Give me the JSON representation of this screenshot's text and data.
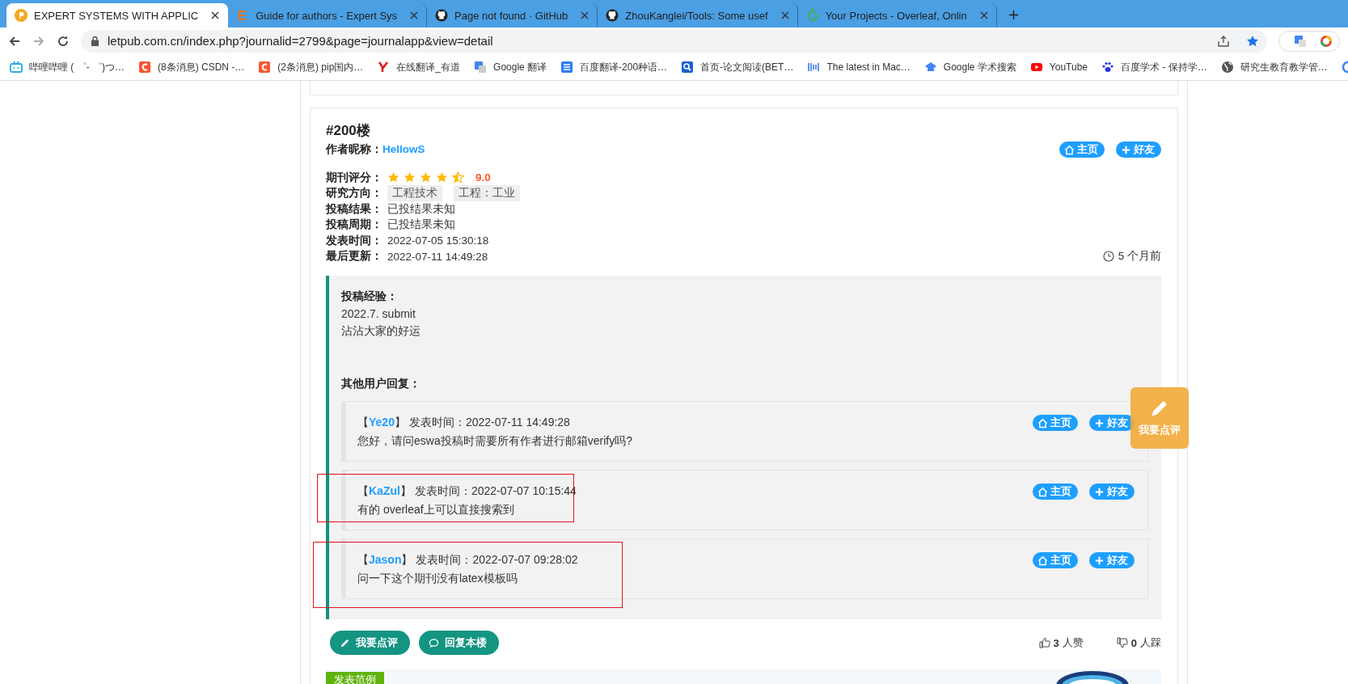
{
  "browser": {
    "tabs": [
      {
        "kind": "letpub",
        "title": "EXPERT SYSTEMS WITH APPLIC",
        "selected": true
      },
      {
        "kind": "elsevier",
        "title": "Guide for authors - Expert Sys",
        "selected": false
      },
      {
        "kind": "github",
        "title": "Page not found · GitHub",
        "selected": false
      },
      {
        "kind": "github",
        "title": "ZhouKanglei/Tools: Some usef",
        "selected": false
      },
      {
        "kind": "overleaf",
        "title": "Your Projects - Overleaf, Onlin",
        "selected": false
      }
    ],
    "address": {
      "url": "letpub.com.cn/index.php?journalid=2799&page=journalapp&view=detail"
    },
    "bookmarks": [
      {
        "kind": "bilibili",
        "title": "哔哩哔哩 ( ゜- ゜)つ…"
      },
      {
        "kind": "csdn",
        "title": "(8条消息) CSDN -…"
      },
      {
        "kind": "csdn",
        "title": "(2条消息) pip国内…"
      },
      {
        "kind": "youdao",
        "title": "在线翻译_有道"
      },
      {
        "kind": "gtranslate",
        "title": "Google 翻译"
      },
      {
        "kind": "baidufanyi",
        "title": "百度翻译-200种语…"
      },
      {
        "kind": "search",
        "title": "首页-论文阅读(BET…"
      },
      {
        "kind": "bars",
        "title": "The latest in Mac…"
      },
      {
        "kind": "scholar",
        "title": "Google 学术搜索"
      },
      {
        "kind": "youtube",
        "title": "YouTube"
      },
      {
        "kind": "paw",
        "title": "百度学术 - 保持学…"
      },
      {
        "kind": "globe",
        "title": "研究生教育教学管…"
      },
      {
        "kind": "google"
      }
    ]
  },
  "post": {
    "floor": "#200楼",
    "author_label": "作者昵称：",
    "author": "HellowS",
    "home_button": "主页",
    "friend_button": "好友",
    "fields": [
      {
        "kind": "rating",
        "label": "期刊评分：",
        "stars": 4.5,
        "score": "9.0"
      },
      {
        "kind": "tags",
        "label": "研究方向：",
        "tags": [
          "工程技术",
          "工程：工业"
        ]
      },
      {
        "kind": "text",
        "label": "投稿结果：",
        "value": "已投结果未知"
      },
      {
        "kind": "text",
        "label": "投稿周期：",
        "value": "已投结果未知"
      },
      {
        "kind": "text",
        "label": "发表时间：",
        "value": "2022-07-05 15:30:18"
      },
      {
        "kind": "text",
        "label": "最后更新：",
        "value": "2022-07-11 14:49:28"
      }
    ],
    "time_ago": "5 个月前",
    "experience_label": "投稿经验：",
    "experience": [
      "2022.7. submit",
      "沾沾大家的好运"
    ],
    "replies_label": "其他用户回复：",
    "replies": [
      {
        "open": "【",
        "user": "Ye20",
        "close": "】",
        "time_label": "发表时间：",
        "time": "2022-07-11 14:49:28",
        "text": "您好，请问eswa投稿时需要所有作者进行邮箱verify吗?",
        "home_button": "主页",
        "friend_button": "好友",
        "highlighted": false
      },
      {
        "open": "【",
        "user": "KaZul",
        "close": "】",
        "time_label": "发表时间：",
        "time": "2022-07-07 10:15:44",
        "text": "有的 overleaf上可以直接搜索到",
        "home_button": "主页",
        "friend_button": "好友",
        "highlighted": true
      },
      {
        "open": "【",
        "user": "Jason",
        "close": "】",
        "time_label": "发表时间：",
        "time": "2022-07-07 09:28:02",
        "text": "问一下这个期刊没有latex模板吗",
        "home_button": "主页",
        "friend_button": "好友",
        "highlighted": true
      }
    ],
    "review_button": "我要点评",
    "reply_button": "回复本楼",
    "likes": {
      "count": "3",
      "label": "人赞"
    },
    "dislikes": {
      "count": "0",
      "label": "人踩"
    }
  },
  "float_button": {
    "label": "我要点评"
  },
  "examples": {
    "tag": "发表范例"
  }
}
